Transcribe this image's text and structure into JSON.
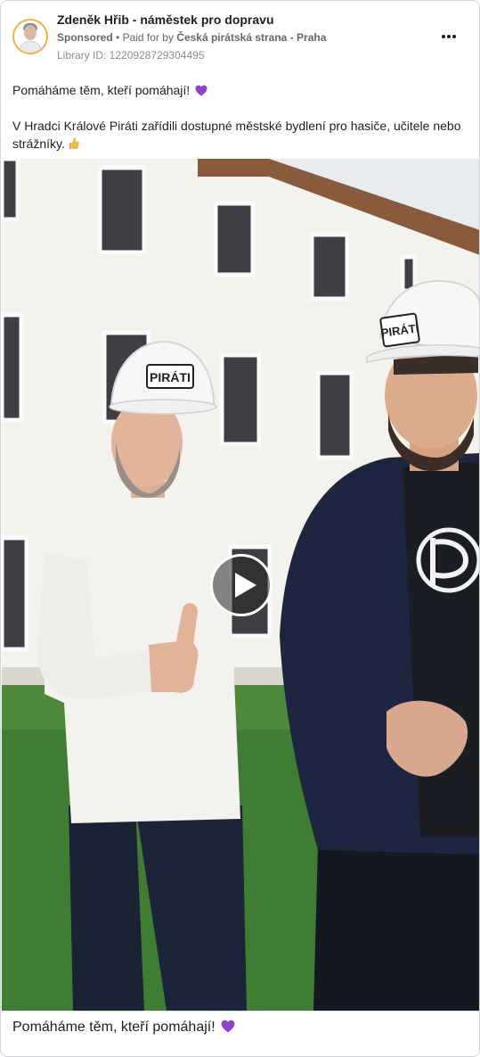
{
  "ad": {
    "page_name": "Zdeněk Hřib - náměstek pro dopravu",
    "sponsored_label": "Sponsored",
    "separator": "•",
    "paid_for_prefix": "Paid for by",
    "payer": "Česká pirátská strana - Praha",
    "library_id": "Library ID: 1220928729304495",
    "more_icon": "more-horizontal-icon"
  },
  "post": {
    "line1": "Pomáháme těm, kteří pomáhají!",
    "line1_emoji": "purple-heart-icon",
    "line2": "V Hradci Králové Piráti zařídili dostupné městské bydlení pro hasiče, učitele nebo strážníky.",
    "line2_emoji": "thumbs-up-icon"
  },
  "media": {
    "helmet_left_text": "PIRÁTI",
    "helmet_right_text": "PIRÁTI",
    "play_icon": "play-icon"
  },
  "caption": {
    "text": "Pomáháme těm, kteří pomáhají!",
    "emoji": "purple-heart-icon"
  },
  "colors": {
    "heart": "#8e44c7",
    "avatar_ring": "#f3b04a",
    "jacket": "#1d2540",
    "grass": "#3f7d34"
  }
}
